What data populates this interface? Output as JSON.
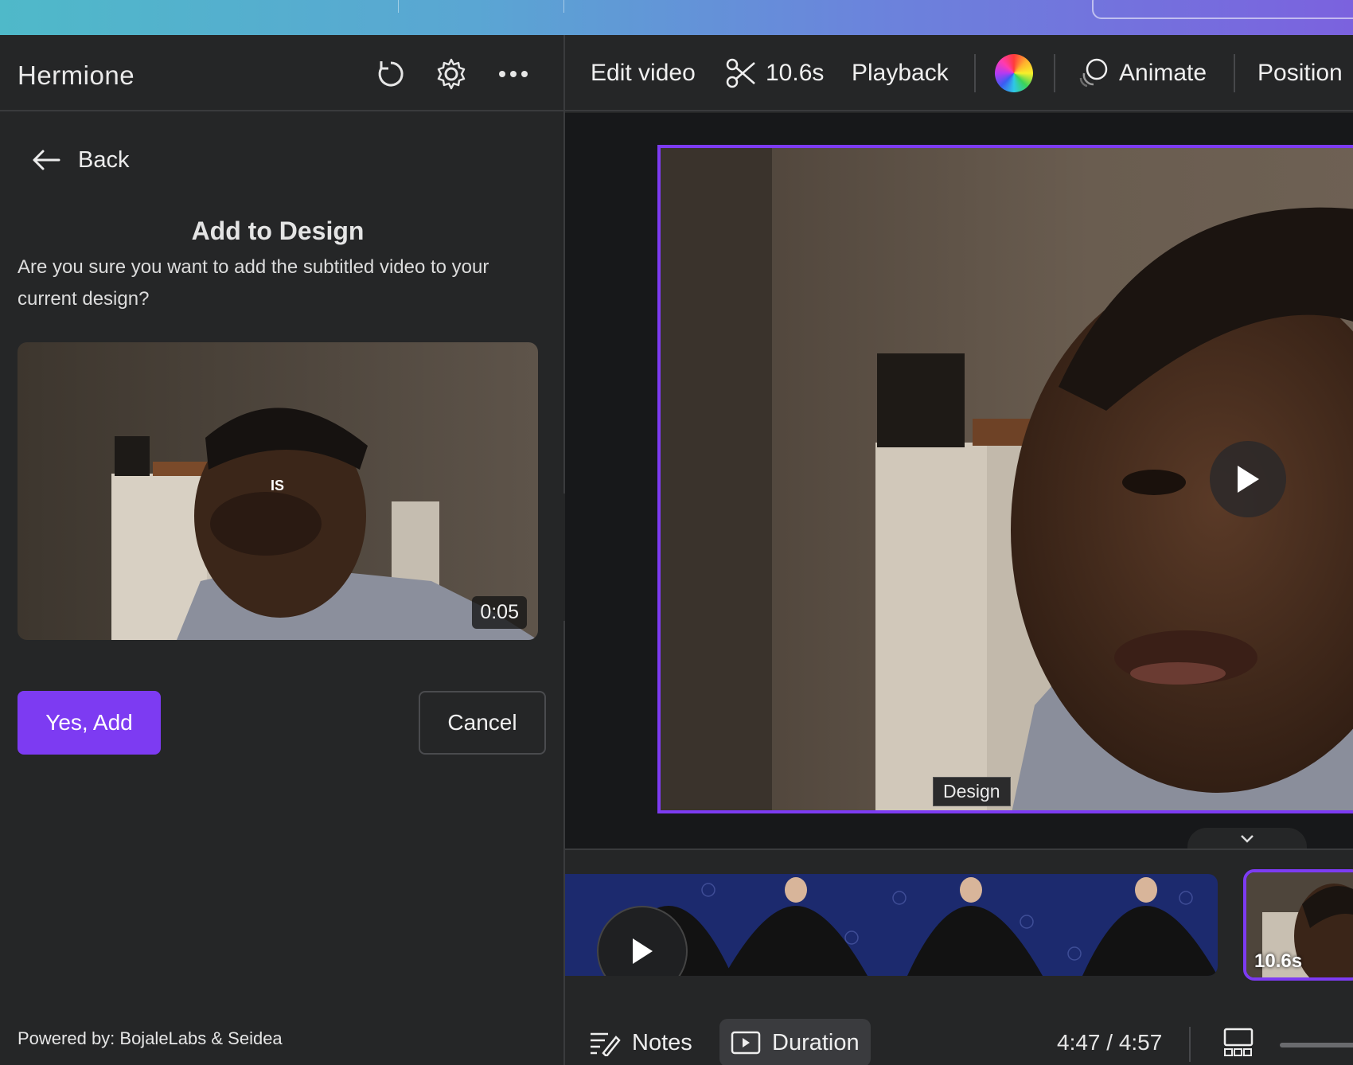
{
  "left_panel": {
    "app_title": "Hermione",
    "back_label": "Back",
    "modal_title": "Add to Design",
    "modal_description": "Are you sure you want to add the subtitled video to your current design?",
    "preview": {
      "subtitle_word": "IS",
      "duration": "0:05"
    },
    "primary_button": "Yes, Add",
    "secondary_button": "Cancel",
    "footer": "Powered by: BojaleLabs & Seidea"
  },
  "toolbar": {
    "edit_video": "Edit video",
    "trim_duration": "10.6s",
    "playback": "Playback",
    "animate": "Animate",
    "position": "Position"
  },
  "canvas": {
    "page_label": "Design"
  },
  "timeline": {
    "clip_duration": "10.6s"
  },
  "bottombar": {
    "notes": "Notes",
    "duration": "Duration",
    "time_display": "4:47 / 4:57"
  },
  "colors": {
    "accent": "#7d3bf2",
    "panel_bg": "#252627",
    "canvas_bg": "#17181a",
    "timeline_blue": "#1c2a6e"
  },
  "icons": [
    "refresh-icon",
    "gear-icon",
    "more-icon",
    "back-arrow-icon",
    "scissors-icon",
    "color-wheel-icon",
    "animate-icon",
    "play-icon",
    "chevron-left-icon",
    "chevron-down-icon",
    "notes-icon",
    "duration-icon",
    "grid-view-icon"
  ]
}
